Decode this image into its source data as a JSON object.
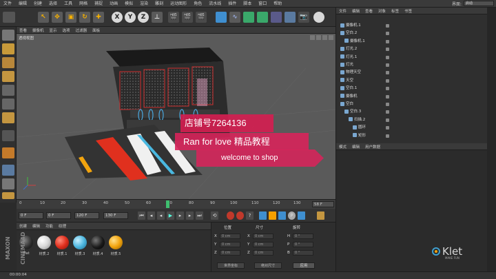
{
  "menubar": {
    "items": [
      "文件",
      "编辑",
      "创建",
      "选择",
      "工具",
      "网格",
      "捕捉",
      "动画",
      "模拟",
      "渲染",
      "雕刻",
      "运动图形",
      "角色",
      "流水线",
      "插件",
      "脚本",
      "窗口",
      "帮助"
    ],
    "layout_label": "界面:",
    "layout_value": "启动"
  },
  "viewport": {
    "menu": [
      "查看",
      "摄像机",
      "显示",
      "选项",
      "过滤器",
      "面板"
    ],
    "label": "透视视图"
  },
  "timeline": {
    "ticks": [
      "0",
      "10",
      "20",
      "30",
      "40",
      "50",
      "60",
      "70",
      "80",
      "90",
      "100",
      "110",
      "120",
      "130"
    ],
    "current_frame": 0.47,
    "end_label": "58 F"
  },
  "transport": {
    "start": "0 F",
    "min": "0 F",
    "max": "120 F",
    "end": "130 F"
  },
  "materials": {
    "menu": [
      "创建",
      "编辑",
      "功能",
      "纹理"
    ],
    "items": [
      {
        "label": "Mat",
        "color": "#2a2a2a"
      },
      {
        "label": "材质.2",
        "color": "#d8d8d8"
      },
      {
        "label": "材质.1",
        "color": "#e0301e"
      },
      {
        "label": "材质.3",
        "color": "#4fb8e0"
      },
      {
        "label": "材质.4",
        "color": "#1a1a1a"
      },
      {
        "label": "材质.5",
        "color": "#f2a40e"
      }
    ],
    "brand": "MAXON CINEMA4D"
  },
  "coords": {
    "headers": [
      "位置",
      "尺寸",
      "旋转"
    ],
    "rows": [
      {
        "axis": "X",
        "pos": "0 cm",
        "size": "0 cm",
        "rot_axis": "H",
        "rot": "0 °"
      },
      {
        "axis": "Y",
        "pos": "0 cm",
        "size": "0 cm",
        "rot_axis": "P",
        "rot": "0 °"
      },
      {
        "axis": "Z",
        "pos": "0 cm",
        "size": "0 cm",
        "rot_axis": "B",
        "rot": "0 °"
      }
    ],
    "mode1": "世界坐标",
    "mode2": "绝对尺寸",
    "apply": "应用"
  },
  "objects": {
    "menu": [
      "文件",
      "编辑",
      "查看",
      "对象",
      "标签",
      "书签"
    ],
    "rows": [
      {
        "name": "摄像机.1",
        "indent": 0
      },
      {
        "name": "空白.2",
        "indent": 0
      },
      {
        "name": "摄像机.1",
        "indent": 1
      },
      {
        "name": "灯光.2",
        "indent": 0
      },
      {
        "name": "灯光.1",
        "indent": 0
      },
      {
        "name": "灯光",
        "indent": 0
      },
      {
        "name": "物理天空",
        "indent": 0
      },
      {
        "name": "天空",
        "indent": 0
      },
      {
        "name": "空白.1",
        "indent": 0
      },
      {
        "name": "摄像机",
        "indent": 0
      },
      {
        "name": "空白",
        "indent": 0
      },
      {
        "name": "空白.3",
        "indent": 1
      },
      {
        "name": "扫描.2",
        "indent": 2
      },
      {
        "name": "圆环",
        "indent": 3
      },
      {
        "name": "矩形",
        "indent": 3
      }
    ]
  },
  "attributes": {
    "menu": [
      "模式",
      "编辑",
      "用户数据"
    ]
  },
  "banners": {
    "line1": "店铺号7264136",
    "line2": "Ran for love 精品教程",
    "line3": "welcome to shop"
  },
  "status": {
    "time": "00:00:04"
  },
  "watermark": {
    "name": "Klet",
    "sub": "MAKE FUN"
  },
  "colors": {
    "accent_red": "#d01f4f",
    "playhead": "#3fbf6f"
  }
}
